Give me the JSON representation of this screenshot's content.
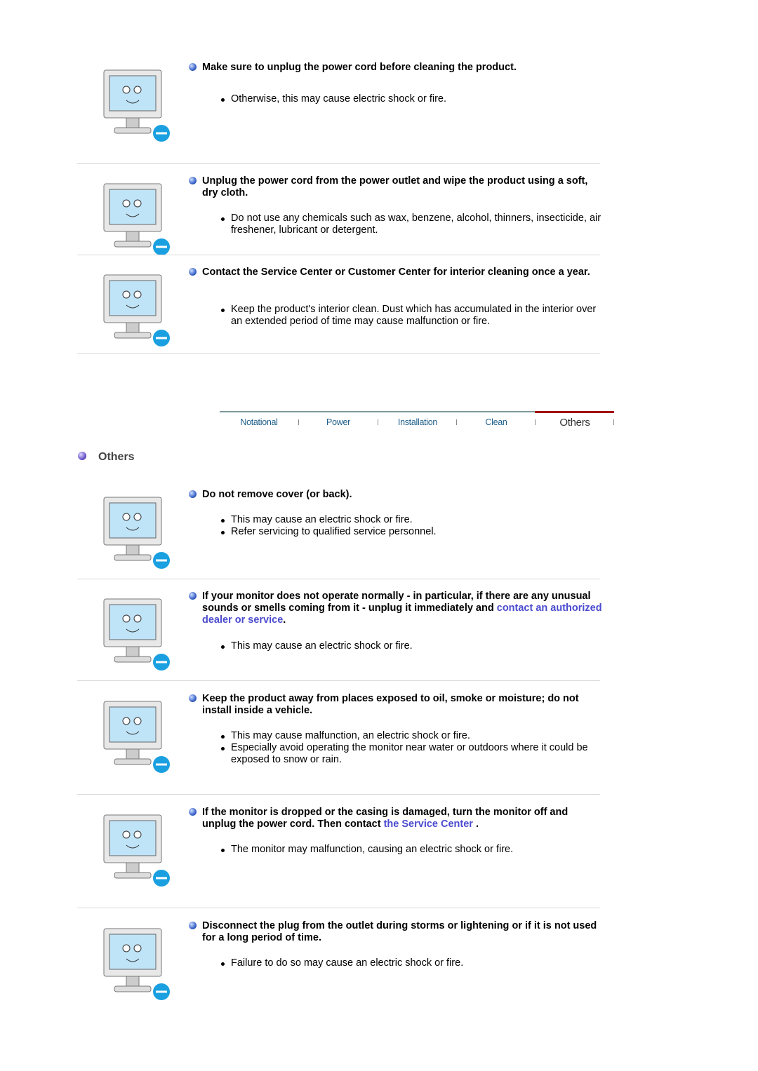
{
  "sections_top": [
    {
      "heading": "Make sure to unplug the power cord before cleaning the product.",
      "bullets": [
        "Otherwise, this may cause electric shock or fire."
      ]
    },
    {
      "heading": "Unplug the power cord from the power outlet and wipe the product using a soft, dry cloth.",
      "bullets": [
        "Do not use any chemicals such as wax, benzene, alcohol, thinners, insecticide, air freshener, lubricant or detergent."
      ]
    },
    {
      "heading": "Contact the Service Center or Customer Center for interior cleaning once a year.",
      "bullets": [
        "Keep the product's interior clean. Dust which has accumulated in the interior over an extended period of time may cause malfunction or fire."
      ]
    }
  ],
  "nav": {
    "items": [
      "Notational",
      "Power",
      "Installation",
      "Clean",
      "Others"
    ],
    "active": "Others",
    "accent": "#a01010"
  },
  "section_title": "Others",
  "sections_others": [
    {
      "heading": "Do not remove cover (or back).",
      "bullets": [
        "This may cause an electric shock or fire.",
        "Refer servicing to qualified service personnel."
      ]
    },
    {
      "heading": "If your monitor does not operate normally - in particular, if there are any unusual sounds or smells coming from it - unplug it immediately and ",
      "link": "contact an authorized dealer or service",
      "heading_end": ".",
      "bullets": [
        "This may cause an electric shock or fire."
      ]
    },
    {
      "heading": "Keep the product away from places exposed to oil, smoke or moisture; do not install inside a vehicle.",
      "bullets": [
        "This may cause malfunction, an electric shock or fire.",
        "Especially avoid operating the monitor near water or outdoors where it could be exposed to snow or rain."
      ]
    },
    {
      "heading": "If the monitor is dropped or the casing is damaged, turn the monitor off and unplug the power cord. Then contact ",
      "link": "the Service Center",
      "heading_end": " .",
      "bullets": [
        "The monitor may malfunction, causing an electric shock or fire."
      ]
    },
    {
      "heading": "Disconnect the plug from the outlet during storms or lightening or if it is not used for a long period of time.",
      "bullets": [
        "Failure to do so may cause an electric shock or fire."
      ]
    }
  ],
  "link_color": "#4b4bcf"
}
